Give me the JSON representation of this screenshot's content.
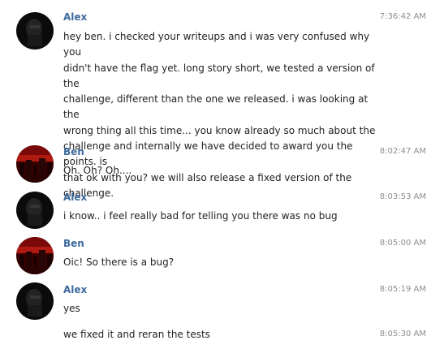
{
  "messages": [
    {
      "sender": "Alex",
      "time": "7:36:42 AM",
      "avatar": "dark-avatar",
      "lines": [
        "hey ben. i checked your writeups and i was very confused why you",
        "didn't have the flag yet. long story short, we tested a version of the",
        "challenge, different than the one we released. i was looking at the",
        "wrong thing all this time... you know already so much about the",
        "challenge and internally we have decided to award you the points. is",
        "that ok with you? we will also release a fixed version of the",
        "challenge."
      ]
    },
    {
      "sender": "Ben",
      "time": "8:02:47 AM",
      "avatar": "red-city-avatar",
      "text": "Oh. Oh? Oh...."
    },
    {
      "sender": "Alex",
      "time": "8:03:53 AM",
      "avatar": "dark-avatar",
      "text": "i know.. i feel really bad for telling you there was no bug"
    },
    {
      "sender": "Ben",
      "time": "8:05:00 AM",
      "avatar": "red-city-avatar",
      "text": "Oic! So there is a bug?"
    },
    {
      "sender": "Alex",
      "time": "8:05:19 AM",
      "avatar": "dark-avatar",
      "text": "yes"
    },
    {
      "continuation": true,
      "time": "8:05:30 AM",
      "text": "we fixed it and reran the tests"
    }
  ]
}
